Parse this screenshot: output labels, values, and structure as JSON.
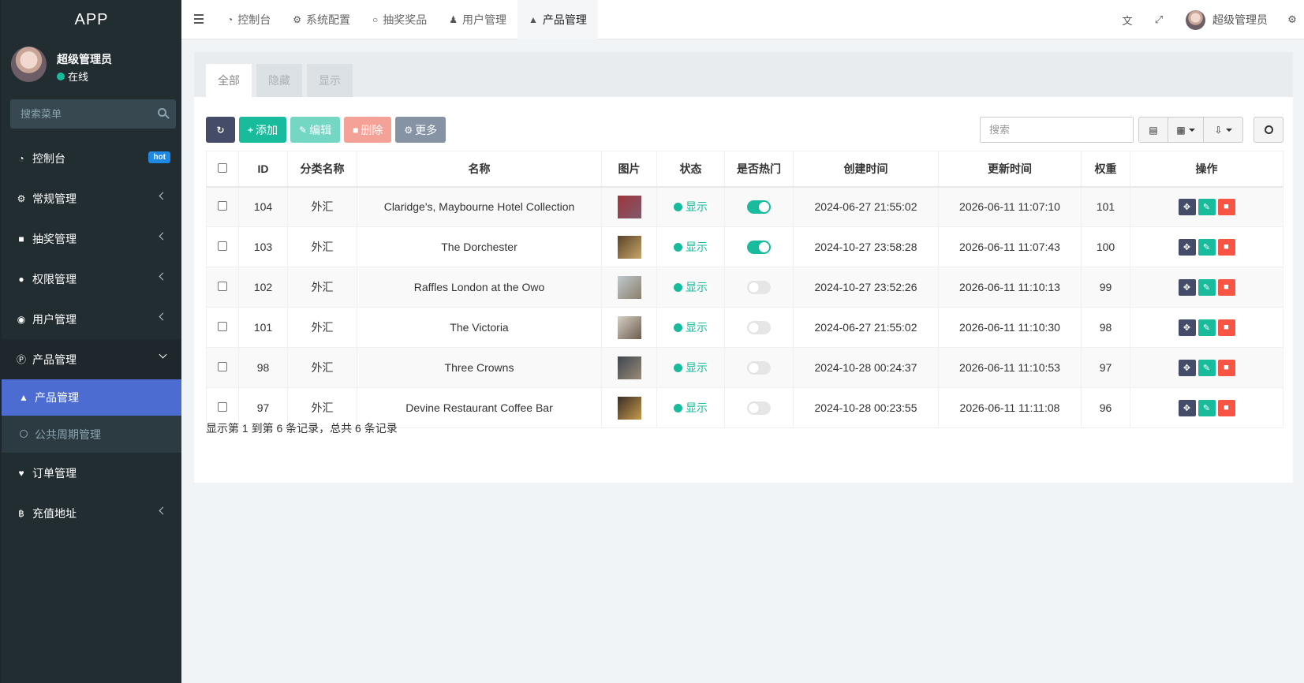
{
  "sidebar": {
    "brand": "APP",
    "user": {
      "name": "超级管理员",
      "status": "在线"
    },
    "search_placeholder": "搜索菜单",
    "items": [
      {
        "label": "控制台",
        "icon": "dashboard-icon",
        "badge": "hot"
      },
      {
        "label": "常规管理",
        "icon": "cogs-icon"
      },
      {
        "label": "抽奖管理",
        "icon": "gift-icon"
      },
      {
        "label": "权限管理",
        "icon": "group-icon"
      },
      {
        "label": "用户管理",
        "icon": "user-circle-icon"
      },
      {
        "label": "产品管理",
        "icon": "product-icon"
      },
      {
        "label": "订单管理",
        "icon": "heartbeat-icon"
      },
      {
        "label": "充值地址",
        "icon": "bitcoin-icon"
      }
    ],
    "submenu": [
      {
        "label": "产品管理",
        "icon": "shopping-bag-icon"
      },
      {
        "label": "公共周期管理",
        "icon": "circle-icon"
      }
    ]
  },
  "topbar": {
    "tabs": [
      {
        "label": "控制台",
        "icon": "dashboard-icon"
      },
      {
        "label": "系统配置",
        "icon": "cog-icon"
      },
      {
        "label": "抽奖奖品",
        "icon": "circle-icon"
      },
      {
        "label": "用户管理",
        "icon": "user-icon"
      },
      {
        "label": "产品管理",
        "icon": "shopping-bag-icon"
      }
    ],
    "user_name": "超级管理员"
  },
  "content": {
    "tabs": [
      "全部",
      "隐藏",
      "显示"
    ],
    "buttons": {
      "add": "添加",
      "edit": "编辑",
      "delete": "删除",
      "more": "更多"
    },
    "search_placeholder": "搜索",
    "columns": [
      "ID",
      "分类名称",
      "名称",
      "图片",
      "状态",
      "是否热门",
      "创建时间",
      "更新时间",
      "权重",
      "操作"
    ],
    "rows": [
      {
        "id": "104",
        "category": "外汇",
        "name": "Claridge's, Maybourne Hotel Collection",
        "status": "显示",
        "hot": true,
        "created": "2024-06-27 21:55:02",
        "updated": "2026-06-11 11:07:10",
        "weight": "101",
        "thumb_colors": [
          "#a0353b",
          "#7d5a6d"
        ]
      },
      {
        "id": "103",
        "category": "外汇",
        "name": "The Dorchester",
        "status": "显示",
        "hot": true,
        "created": "2024-10-27 23:58:28",
        "updated": "2026-06-11 11:07:43",
        "weight": "100",
        "thumb_colors": [
          "#5a4328",
          "#c8a66a"
        ]
      },
      {
        "id": "102",
        "category": "外汇",
        "name": "Raffles London at the Owo",
        "status": "显示",
        "hot": false,
        "created": "2024-10-27 23:52:26",
        "updated": "2026-06-11 11:10:13",
        "weight": "99",
        "thumb_colors": [
          "#bfc9cf",
          "#8c7f6b"
        ]
      },
      {
        "id": "101",
        "category": "外汇",
        "name": "The Victoria",
        "status": "显示",
        "hot": false,
        "created": "2024-06-27 21:55:02",
        "updated": "2026-06-11 11:10:30",
        "weight": "98",
        "thumb_colors": [
          "#d5cfc4",
          "#6d5d4e"
        ]
      },
      {
        "id": "98",
        "category": "外汇",
        "name": "Three Crowns",
        "status": "显示",
        "hot": false,
        "created": "2024-10-28 00:24:37",
        "updated": "2026-06-11 11:10:53",
        "weight": "97",
        "thumb_colors": [
          "#3e4750",
          "#9a8a76"
        ]
      },
      {
        "id": "97",
        "category": "外汇",
        "name": "Devine Restaurant Coffee Bar",
        "status": "显示",
        "hot": false,
        "created": "2024-10-28 00:23:55",
        "updated": "2026-06-11 11:11:08",
        "weight": "96",
        "thumb_colors": [
          "#3a2e26",
          "#c79a4a"
        ]
      }
    ],
    "summary": "显示第 1 到第 6 条记录，总共 6 条记录"
  }
}
